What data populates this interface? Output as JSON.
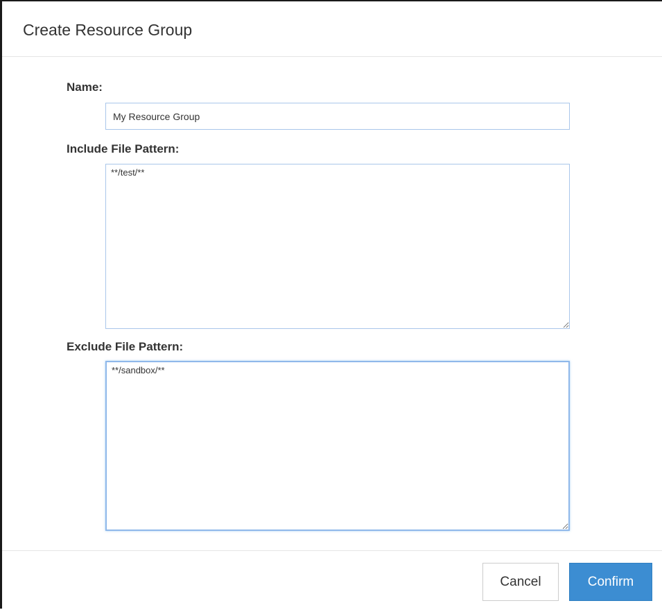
{
  "dialog": {
    "title": "Create Resource Group"
  },
  "form": {
    "name": {
      "label": "Name:",
      "value": "My Resource Group"
    },
    "include": {
      "label": "Include File Pattern:",
      "value": "**/test/**"
    },
    "exclude": {
      "label": "Exclude File Pattern:",
      "value": "**/sandbox/**"
    }
  },
  "footer": {
    "cancel_label": "Cancel",
    "confirm_label": "Confirm"
  },
  "colors": {
    "primary": "#3c8dd2",
    "input_border": "#a9c6ea",
    "focus_border": "#8fb8ea",
    "text": "#333333"
  }
}
